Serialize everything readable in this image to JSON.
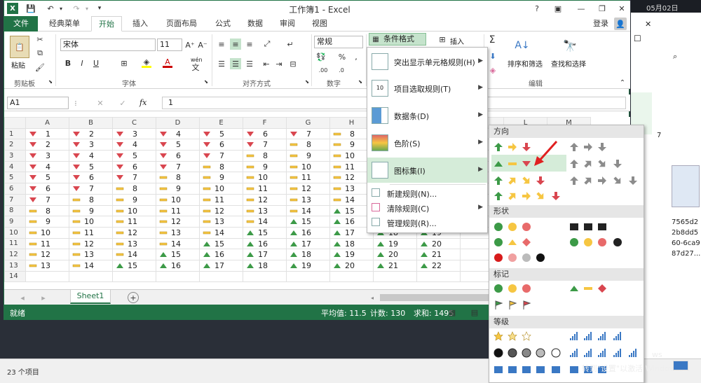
{
  "window": {
    "title": "工作簿1 - Excel",
    "signin": "登录"
  },
  "desktop": {
    "time": "05月02日",
    "explorer_status": "23 个项目",
    "explorer_texts": [
      "7565d2",
      "2b8dd5",
      "60-6ca9",
      "87d27..."
    ],
    "explorer_num": "7"
  },
  "tabs": [
    "文件",
    "经典菜单",
    "开始",
    "插入",
    "页面布局",
    "公式",
    "数据",
    "审阅",
    "视图"
  ],
  "ribbon": {
    "paste": "粘贴",
    "clipboard": "剪贴板",
    "font_name": "宋体",
    "font_size": "11",
    "font_group": "字体",
    "align_group": "对齐方式",
    "number_format": "常规",
    "number_group": "数字",
    "cond_format": "条件格式",
    "insert": "插入",
    "sort_filter": "排序和筛选",
    "find_select": "查找和选择",
    "edit_group": "编辑",
    "wen_label": "wén"
  },
  "formula": {
    "name_box": "A1",
    "fx": "fx",
    "value": "1"
  },
  "columns": [
    "A",
    "B",
    "C",
    "D",
    "E",
    "F",
    "G",
    "H",
    "I",
    "J",
    "K",
    "L",
    "M"
  ],
  "rows": [
    [
      1,
      2,
      3,
      4,
      5,
      6,
      7,
      8,
      "",
      "",
      ""
    ],
    [
      2,
      3,
      4,
      5,
      6,
      7,
      8,
      9,
      "",
      "",
      ""
    ],
    [
      3,
      4,
      5,
      6,
      7,
      8,
      9,
      10,
      "",
      "",
      ""
    ],
    [
      4,
      5,
      6,
      7,
      8,
      9,
      10,
      11,
      "",
      "",
      ""
    ],
    [
      5,
      6,
      7,
      8,
      9,
      10,
      11,
      12,
      "",
      "",
      ""
    ],
    [
      6,
      7,
      8,
      9,
      10,
      11,
      12,
      13,
      "",
      "",
      ""
    ],
    [
      7,
      8,
      9,
      10,
      11,
      12,
      13,
      14,
      "",
      "",
      ""
    ],
    [
      8,
      9,
      10,
      11,
      12,
      13,
      14,
      15,
      "",
      "",
      ""
    ],
    [
      9,
      10,
      11,
      12,
      13,
      14,
      15,
      16,
      "",
      "",
      ""
    ],
    [
      10,
      11,
      12,
      13,
      14,
      15,
      16,
      17,
      18,
      19,
      ""
    ],
    [
      11,
      12,
      13,
      14,
      15,
      16,
      17,
      18,
      19,
      20,
      ""
    ],
    [
      12,
      13,
      14,
      15,
      16,
      17,
      18,
      19,
      20,
      21,
      ""
    ],
    [
      13,
      14,
      15,
      16,
      17,
      18,
      19,
      20,
      21,
      22,
      ""
    ],
    [
      "",
      "",
      "",
      "",
      "",
      "",
      "",
      "",
      "",
      "",
      ""
    ]
  ],
  "sheet_tab": "Sheet1",
  "status": {
    "ready": "就绪",
    "average": "平均值: 11.5",
    "count": "计数: 130",
    "sum": "求和: 1495"
  },
  "menu": {
    "items": [
      {
        "label": "突出显示单元格规则(H)",
        "arrow": true
      },
      {
        "label": "项目选取规则(T)",
        "arrow": true
      },
      {
        "label": "数据条(D)",
        "arrow": true
      },
      {
        "label": "色阶(S)",
        "arrow": true
      },
      {
        "label": "图标集(I)",
        "arrow": true
      }
    ],
    "small_items": [
      {
        "label": "新建规则(N)..."
      },
      {
        "label": "清除规则(C)",
        "arrow": true
      },
      {
        "label": "管理规则(R)..."
      }
    ],
    "icon_10": "10"
  },
  "iconsets": {
    "sections": [
      "方向",
      "形状",
      "标记",
      "等级"
    ]
  },
  "watermark": "转到\"设置\"以激活 Windows。",
  "activate_tail": "ws",
  "colors": {
    "excel_green": "#217346",
    "menu_highlight": "#d5ecd9",
    "up_green": "#3c9a47",
    "down_red": "#d9464f",
    "mid_yellow": "#f6c642"
  }
}
